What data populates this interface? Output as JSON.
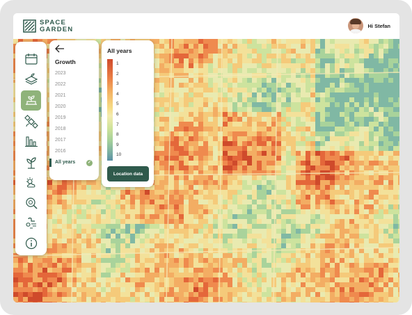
{
  "brand": {
    "line1": "SPACE",
    "line2": "GARDEN",
    "color": "#2f5a4c"
  },
  "user": {
    "greeting": "Hi Stefan"
  },
  "sidebar": {
    "items": [
      {
        "icon": "calendar-icon",
        "active": false
      },
      {
        "icon": "soil-layers-icon",
        "active": false
      },
      {
        "icon": "growth-plant-icon",
        "active": true
      },
      {
        "icon": "satellite-icon",
        "active": false
      },
      {
        "icon": "bar-chart-icon",
        "active": false
      },
      {
        "icon": "sprout-icon",
        "active": false
      },
      {
        "icon": "weather-icon",
        "active": false
      },
      {
        "icon": "search-field-icon",
        "active": false
      },
      {
        "icon": "irrigation-icon",
        "active": false
      },
      {
        "icon": "info-icon",
        "active": false
      }
    ]
  },
  "growth": {
    "title": "Growth",
    "years": [
      "2023",
      "2022",
      "2021",
      "2020",
      "2019",
      "2018",
      "2017",
      "2016",
      "All years"
    ],
    "selected": "All years"
  },
  "legend": {
    "title": "All years",
    "ticks": [
      "1",
      "2",
      "3",
      "4",
      "5",
      "6",
      "7",
      "8",
      "9",
      "10"
    ],
    "button": "Location data"
  },
  "colors": {
    "accent": "#8fb37a",
    "dark": "#2f5a4c",
    "high": "#cf4a2b",
    "low": "#5b90a4"
  }
}
